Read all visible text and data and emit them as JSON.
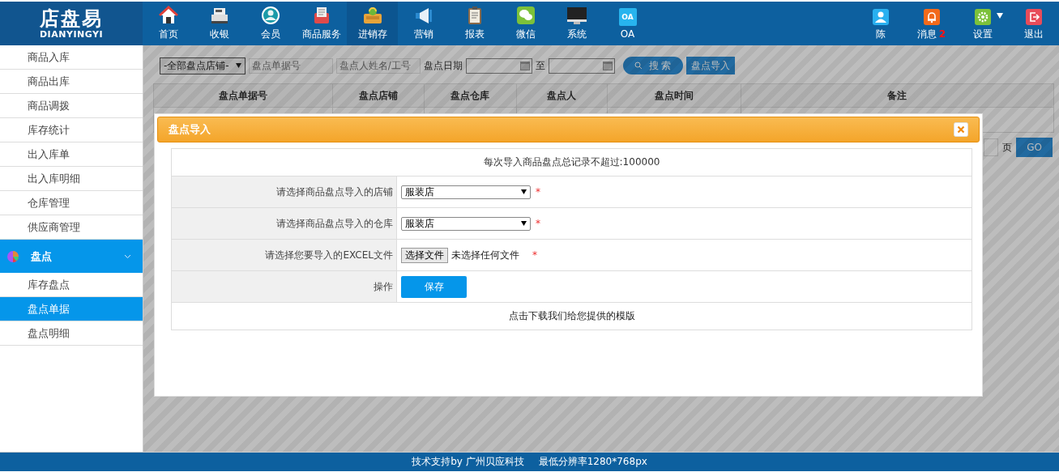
{
  "logo": {
    "title": "店盘易",
    "subtitle": "DIANYINGYI"
  },
  "nav": [
    {
      "label": "首页",
      "selected": false
    },
    {
      "label": "收银",
      "selected": false
    },
    {
      "label": "会员",
      "selected": false
    },
    {
      "label": "商品服务",
      "selected": false
    },
    {
      "label": "进销存",
      "selected": true
    },
    {
      "label": "营销",
      "selected": false
    },
    {
      "label": "报表",
      "selected": false
    },
    {
      "label": "微信",
      "selected": false
    },
    {
      "label": "系统",
      "selected": false
    },
    {
      "label": "OA",
      "icon_text": "OA",
      "selected": false
    }
  ],
  "user_menu": [
    {
      "label": "陈"
    },
    {
      "label": "消息",
      "badge": "2"
    },
    {
      "label": "设置",
      "dropdown": true
    },
    {
      "label": "退出"
    }
  ],
  "sidebar": {
    "items": [
      {
        "label": "商品入库",
        "selected": false
      },
      {
        "label": "商品出库",
        "selected": false
      },
      {
        "label": "商品调拨",
        "selected": false
      },
      {
        "label": "库存统计",
        "selected": false
      },
      {
        "label": "出入库单",
        "selected": false
      },
      {
        "label": "出入库明细",
        "selected": false
      },
      {
        "label": "仓库管理",
        "selected": false
      },
      {
        "label": "供应商管理",
        "selected": false
      }
    ],
    "section": {
      "label": "盘点",
      "expanded": true,
      "children": [
        {
          "label": "库存盘点",
          "selected": false
        },
        {
          "label": "盘点单据",
          "selected": true
        },
        {
          "label": "盘点明细",
          "selected": false
        }
      ]
    }
  },
  "filters": {
    "store": "-全部盘点店铺-",
    "order_no": {
      "placeholder": "盘点单据号"
    },
    "person": {
      "placeholder": "盘点人姓名/工号"
    },
    "date_label": "盘点日期",
    "to_label": "至",
    "search_button": "搜 索",
    "import_button": "盘点导入"
  },
  "table": {
    "columns": [
      "盘点单据号",
      "盘点店铺",
      "盘点仓库",
      "盘点人",
      "盘点时间",
      "备注"
    ]
  },
  "pagination": {
    "page_label": "页",
    "go_button": "GO"
  },
  "dialog": {
    "title": "盘点导入",
    "notice": "每次导入商品盘点总记录不超过:100000",
    "rows": [
      {
        "kind": "select",
        "label": "请选择商品盘点导入的店铺",
        "value": "服装店",
        "required_mark": "*"
      },
      {
        "kind": "select",
        "label": "请选择商品盘点导入的仓库",
        "value": "服装店",
        "required_mark": "*"
      },
      {
        "kind": "file",
        "label": "请选择您要导入的EXCEL文件",
        "button": "选择文件",
        "value": "未选择任何文件",
        "required_mark": "*"
      },
      {
        "kind": "button",
        "label": "操作",
        "button": "保存"
      }
    ],
    "download_link": "点击下载我们给您提供的模版"
  },
  "footer": {
    "support": "技术支持by 广州贝应科技",
    "resolution": "最低分辨率1280*768px"
  }
}
